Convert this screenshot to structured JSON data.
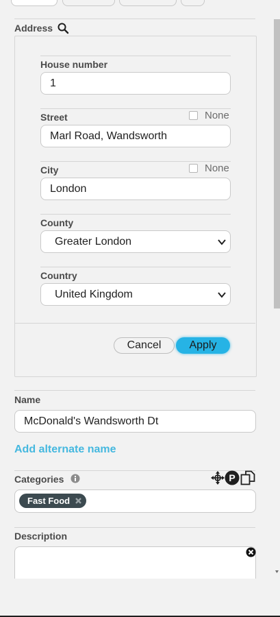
{
  "address": {
    "label": "Address",
    "house_number_label": "House number",
    "house_number_value": "1",
    "street_label": "Street",
    "street_value": "Marl Road, Wandsworth",
    "street_none_label": "None",
    "city_label": "City",
    "city_value": "London",
    "city_none_label": "None",
    "county_label": "County",
    "county_value": "Greater London",
    "country_label": "Country",
    "country_value": "United Kingdom",
    "cancel_label": "Cancel",
    "apply_label": "Apply"
  },
  "name": {
    "label": "Name",
    "value": "McDonald's Wandsworth Dt",
    "add_alternate_label": "Add alternate name"
  },
  "categories": {
    "label": "Categories",
    "chips": [
      "Fast Food"
    ]
  },
  "description": {
    "label": "Description",
    "value": ""
  },
  "colors": {
    "accent": "#26b3e5",
    "link": "#45b8df",
    "chip": "#3c4a50"
  },
  "icons": [
    "search-icon",
    "info-icon",
    "move-icon",
    "parking-icon",
    "copy-icon",
    "clear-icon",
    "chevron-down-icon",
    "remove-chip-icon"
  ]
}
